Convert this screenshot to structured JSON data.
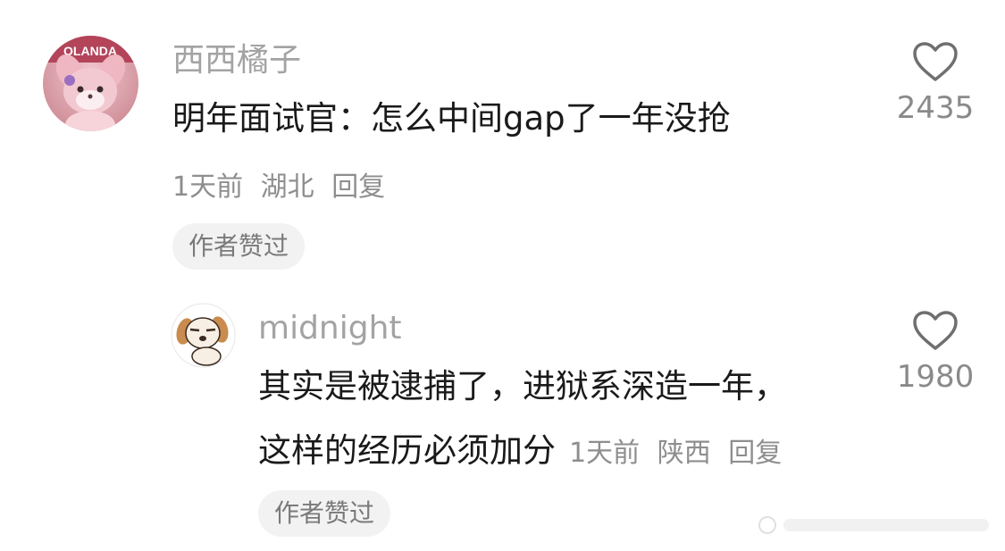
{
  "comment": {
    "avatar": "pink-fox-plush-avatar",
    "username": "西西橘子",
    "content": "明年面试官：怎么中间gap了一年没抢",
    "meta": {
      "time": "1天前",
      "location": "湖北",
      "reply_label": "回复"
    },
    "badge": "作者赞过",
    "likes": "2435",
    "like_icon": "heart-outline-icon"
  },
  "reply": {
    "avatar": "cartoon-puppy-avatar",
    "username": "midnight",
    "content_line1": "其实是被逮捕了，进狱系深造一年，",
    "content_line2": "这样的经历必须加分",
    "meta": {
      "time": "1天前",
      "location": "陕西",
      "reply_label": "回复"
    },
    "badge": "作者赞过",
    "likes": "1980",
    "like_icon": "heart-outline-icon"
  },
  "colors": {
    "username": "#a3a3a3",
    "content": "#1a1a1a",
    "meta": "#8e8e8e",
    "badge_bg": "#f2f2f2",
    "heart_stroke": "#6f6f6f"
  }
}
